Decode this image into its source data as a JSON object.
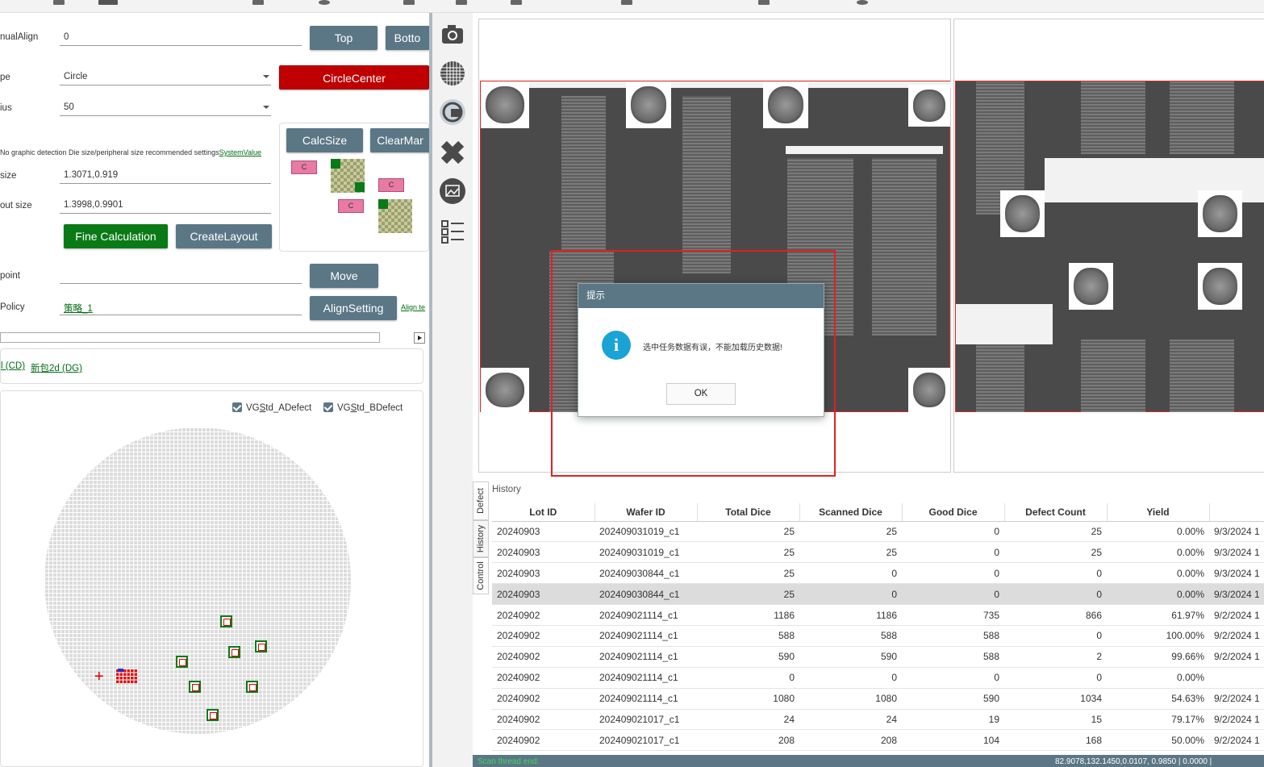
{
  "left": {
    "manual_align": {
      "label": "nualAlign",
      "value": "0"
    },
    "btn_top": "Top",
    "btn_bottom": "Botto",
    "type": {
      "label": "pe",
      "value": "Circle"
    },
    "btn_circle_center": "CircleCenter",
    "radius": {
      "label": "ius",
      "value": "50"
    },
    "btn_calc_size": "CalcSize",
    "btn_clear_mark": "ClearMar",
    "hint": {
      "text": "No graphic detection Die size/peripheral size recommended settings",
      "link": "SystemValue"
    },
    "die_size": {
      "label": "size",
      "value": "1.3071,0.919"
    },
    "layout_size": {
      "label": "out size",
      "value": "1.3998,0.9901"
    },
    "btn_fine_calc": "Fine Calculation",
    "btn_create_layout": "CreateLayout",
    "calc_tags": [
      "C",
      "C",
      "C"
    ],
    "point": {
      "label": "point",
      "value": ""
    },
    "btn_move": "Move",
    "policy": {
      "label": "Policy",
      "value": "策略_1"
    },
    "btn_align_setting": "AlignSetting",
    "align_link": "Align te",
    "recipes": [
      "l (CD)",
      "新包2d (DG)"
    ],
    "checkboxes": [
      {
        "label": "VG",
        "label_u": "S",
        "label_rest": "td_ADefect",
        "checked": true
      },
      {
        "label": "VG",
        "label_u": "S",
        "label_rest": "td_BDefect",
        "checked": true
      }
    ]
  },
  "toolbar_icons": [
    "camera-icon",
    "grid-icon",
    "wafer-scan-icon",
    "ruler-icon",
    "image-icon",
    "checklist-icon"
  ],
  "dialog": {
    "title": "提示",
    "message": "选中任务数据有误，不能加载历史数据!",
    "ok": "OK"
  },
  "history": {
    "tabs": [
      "Defect",
      "History",
      "Control"
    ],
    "title": "History",
    "columns": [
      "Lot ID",
      "Wafer ID",
      "Total Dice",
      "Scanned Dice",
      "Good Dice",
      "Defect Count",
      "Yield",
      ""
    ],
    "rows": [
      [
        "20240903",
        "202409031019_c1",
        "25",
        "25",
        "0",
        "25",
        "0.00%",
        "9/3/2024 1"
      ],
      [
        "20240903",
        "202409031019_c1",
        "25",
        "25",
        "0",
        "25",
        "0.00%",
        "9/3/2024 1"
      ],
      [
        "20240903",
        "202409030844_c1",
        "25",
        "0",
        "0",
        "0",
        "0.00%",
        "9/3/2024 1"
      ],
      [
        "20240903",
        "202409030844_c1",
        "25",
        "0",
        "0",
        "0",
        "0.00%",
        "9/3/2024 1"
      ],
      [
        "20240902",
        "202409021114_c1",
        "1186",
        "1186",
        "735",
        "866",
        "61.97%",
        "9/2/2024 1"
      ],
      [
        "20240902",
        "202409021114_c1",
        "588",
        "588",
        "588",
        "0",
        "100.00%",
        "9/2/2024 1"
      ],
      [
        "20240902",
        "202409021114_c1",
        "590",
        "590",
        "588",
        "2",
        "99.66%",
        "9/2/2024 1"
      ],
      [
        "20240902",
        "202409021114_c1",
        "0",
        "0",
        "0",
        "0",
        "0.00%",
        ""
      ],
      [
        "20240902",
        "202409021114_c1",
        "1080",
        "1080",
        "590",
        "1034",
        "54.63%",
        "9/2/2024 1"
      ],
      [
        "20240902",
        "202409021017_c1",
        "24",
        "24",
        "19",
        "15",
        "79.17%",
        "9/2/2024 1"
      ],
      [
        "20240902",
        "202409021017_c1",
        "208",
        "208",
        "104",
        "168",
        "50.00%",
        "9/2/2024 1"
      ]
    ],
    "selected_row": 3
  },
  "status": {
    "text": "Scan thread end:",
    "coords": "82.9078,132.1450,0.0107, 0.9850 | 0.0000 |"
  },
  "colors": {
    "accent": "#5b7786",
    "danger": "#c00000",
    "success": "#0a7a16",
    "link": "#006e13",
    "info": "#1aa3d4"
  }
}
